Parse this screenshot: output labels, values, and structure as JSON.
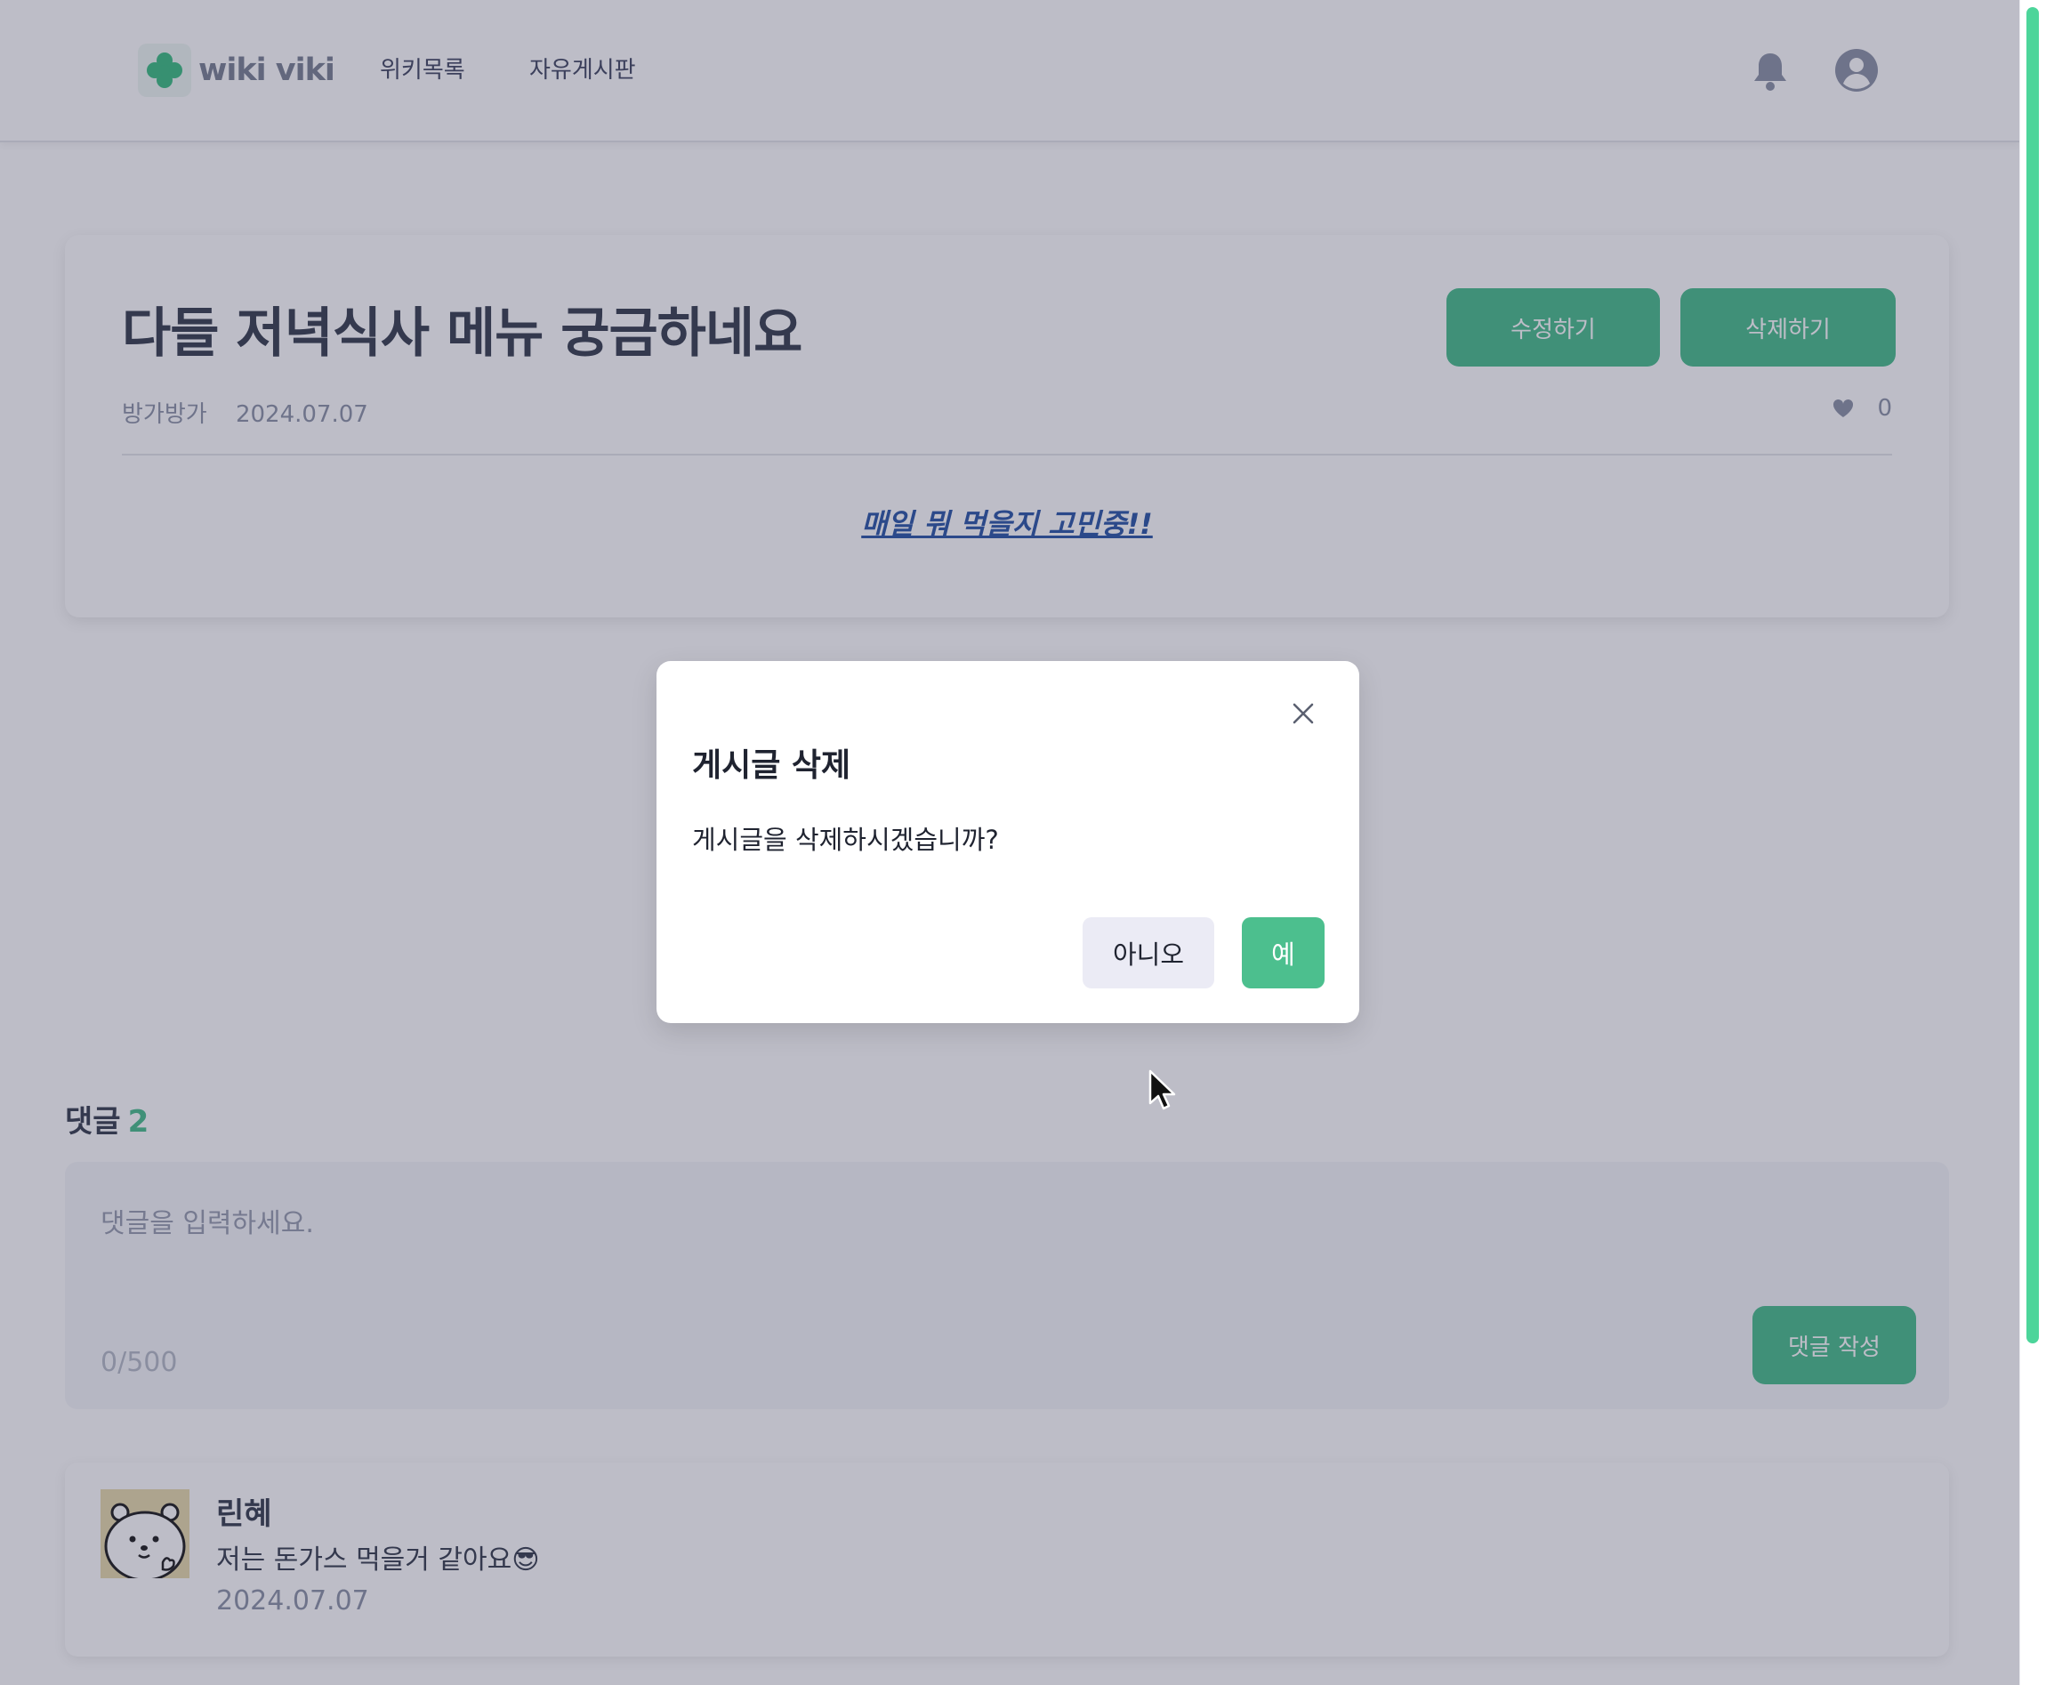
{
  "header": {
    "logo_text": "wiki viki",
    "nav": [
      "위키목록",
      "자유게시판"
    ],
    "notification_icon": "bell-icon",
    "profile_icon": "user-circle-icon"
  },
  "post": {
    "title": "다들 저녁식사 메뉴 궁금하네요",
    "edit_label": "수정하기",
    "delete_label": "삭제하기",
    "author": "방가방가",
    "date": "2024.07.07",
    "like_icon": "heart-icon",
    "like_count": "0",
    "body": "매일 뭐 먹을지 고민중!!"
  },
  "comments": {
    "heading": "댓글",
    "count": "2",
    "input_placeholder": "댓글을 입력하세요.",
    "char_counter": "0/500",
    "submit_label": "댓글 작성",
    "items": [
      {
        "name": "린혜",
        "text": "저는 돈가스 먹을거 같아요😎",
        "date": "2024.07.07"
      }
    ]
  },
  "modal": {
    "title": "게시글 삭제",
    "message": "게시글을 삭제하시겠습니까?",
    "cancel_label": "아니오",
    "confirm_label": "예",
    "close_icon": "close-icon"
  },
  "colors": {
    "accent": "#4cbf8e",
    "overlay": "rgba(35,38,70,0.30)",
    "link": "#2e59a8"
  }
}
